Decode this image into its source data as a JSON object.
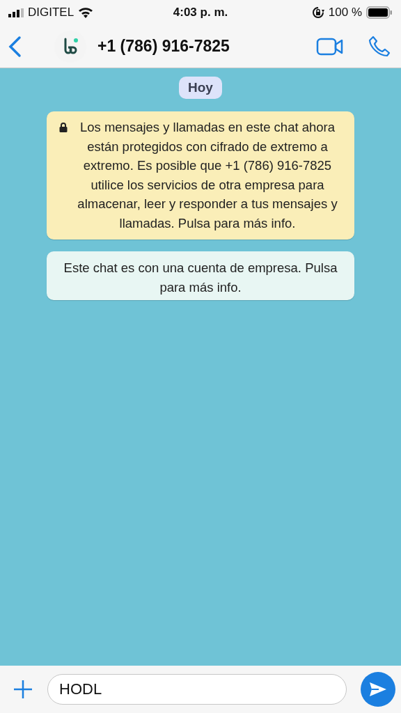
{
  "status_bar": {
    "carrier": "DIGITEL",
    "time": "4:03 p. m.",
    "battery": "100 %"
  },
  "header": {
    "title": "+1 (786) 916-7825"
  },
  "chat": {
    "date_badge": "Hoy",
    "notices": [
      {
        "kind": "encryption",
        "text": "Los mensajes y llamadas en este chat ahora están protegidos con cifrado de extremo a extremo. Es posible que +1 (786) 916-7825 utilice los servicios de otra empresa para almacenar, leer y responder a tus mensajes y llamadas. Pulsa para más info."
      },
      {
        "kind": "business",
        "text": "Este chat es con una cuenta de empresa. Pulsa para más info."
      }
    ]
  },
  "composer": {
    "value": "HODL"
  }
}
